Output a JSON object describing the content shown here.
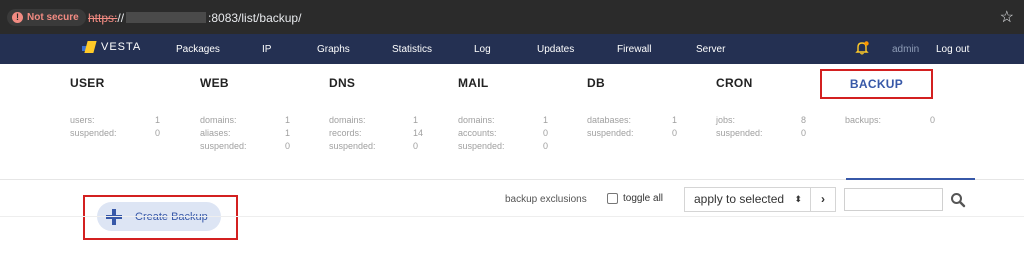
{
  "browser": {
    "security_label": "Not secure",
    "url_scheme": "https:",
    "url_slashes": "//",
    "url_rest": ":8083/list/backup/"
  },
  "nav": {
    "brand": "VESTA",
    "items": [
      "Packages",
      "IP",
      "Graphs",
      "Statistics",
      "Log",
      "Updates",
      "Firewall",
      "Server"
    ],
    "user": "admin",
    "logout": "Log out"
  },
  "stats": {
    "user": {
      "title": "USER",
      "rows": [
        [
          "users:",
          "1"
        ],
        [
          "suspended:",
          "0"
        ]
      ]
    },
    "web": {
      "title": "WEB",
      "rows": [
        [
          "domains:",
          "1"
        ],
        [
          "aliases:",
          "1"
        ],
        [
          "suspended:",
          "0"
        ]
      ]
    },
    "dns": {
      "title": "DNS",
      "rows": [
        [
          "domains:",
          "1"
        ],
        [
          "records:",
          "14"
        ],
        [
          "suspended:",
          "0"
        ]
      ]
    },
    "mail": {
      "title": "MAIL",
      "rows": [
        [
          "domains:",
          "1"
        ],
        [
          "accounts:",
          "0"
        ],
        [
          "suspended:",
          "0"
        ]
      ]
    },
    "db": {
      "title": "DB",
      "rows": [
        [
          "databases:",
          "1"
        ],
        [
          "suspended:",
          "0"
        ]
      ]
    },
    "cron": {
      "title": "CRON",
      "rows": [
        [
          "jobs:",
          "8"
        ],
        [
          "suspended:",
          "0"
        ]
      ]
    },
    "backup": {
      "title": "BACKUP",
      "rows": [
        [
          "backups:",
          "0"
        ]
      ]
    }
  },
  "toolbar": {
    "create_label": "Create Backup",
    "exclusions_label": "backup exclusions",
    "toggle_label": "toggle all",
    "action_select": "apply to selected",
    "search_value": ""
  },
  "colors": {
    "nav_bg": "#243052",
    "accent": "#3758a8",
    "highlight": "#d32020"
  }
}
